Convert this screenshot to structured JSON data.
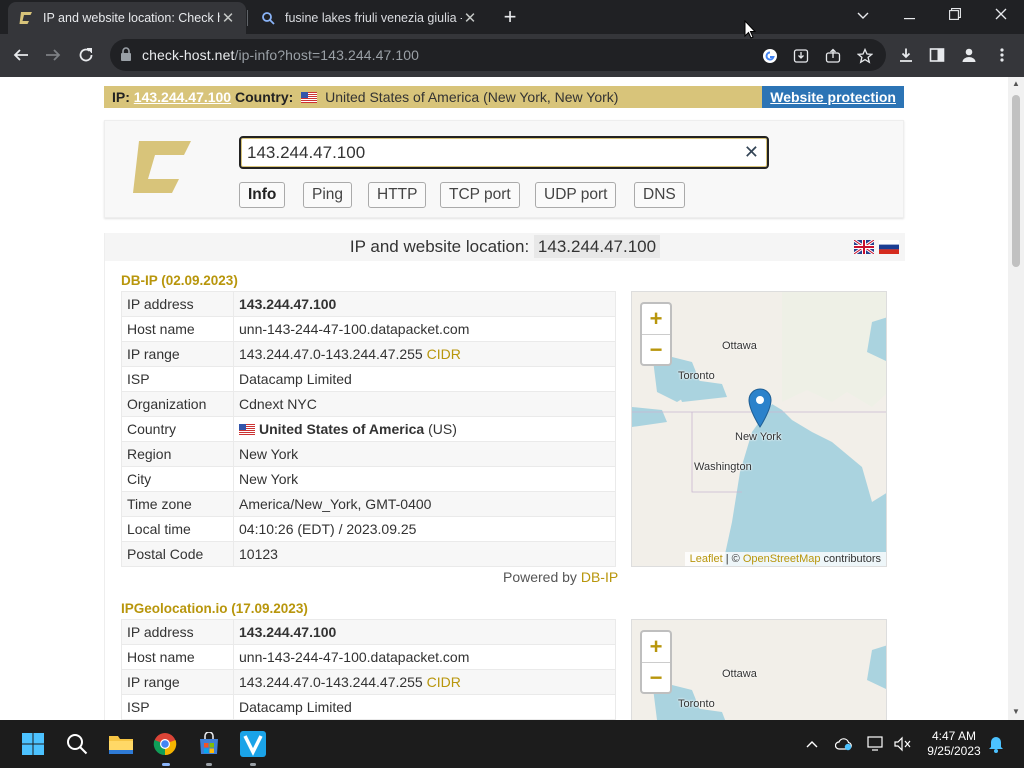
{
  "browser": {
    "tabs": [
      {
        "title": "IP and website location: Check ho",
        "active": true
      },
      {
        "title": "fusine lakes friuli venezia giulia -",
        "active": false
      }
    ],
    "new_tab": "+",
    "url_domain": "check-host.net",
    "url_rest": "/ip-info?host=143.244.47.100"
  },
  "topbar": {
    "ip_label": "IP:",
    "ip": "143.244.47.100",
    "country_label": "Country:",
    "country": "United States of America (New York, New York)",
    "protection": "Website protection"
  },
  "search": {
    "value": "143.244.47.100",
    "buttons": [
      "Info",
      "Ping",
      "HTTP",
      "TCP port",
      "UDP port",
      "DNS"
    ]
  },
  "panel": {
    "heading": "IP and website location:",
    "heading_ip": "143.244.47.100"
  },
  "sources": [
    {
      "title": "DB-IP (02.09.2023)",
      "rows": [
        {
          "key": "IP address",
          "value": "143.244.47.100"
        },
        {
          "key": "Host name",
          "value": "unn-143-244-47-100.datapacket.com"
        },
        {
          "key": "IP range",
          "value": "143.244.47.0-143.244.47.255",
          "extra": "CIDR"
        },
        {
          "key": "ISP",
          "value": "Datacamp Limited"
        },
        {
          "key": "Organization",
          "value": "Cdnext NYC"
        },
        {
          "key": "Country",
          "value": "United States of America",
          "extra": "(US)"
        },
        {
          "key": "Region",
          "value": "New York"
        },
        {
          "key": "City",
          "value": "New York"
        },
        {
          "key": "Time zone",
          "value": "America/New_York, GMT-0400"
        },
        {
          "key": "Local time",
          "value": "04:10:26 (EDT) / 2023.09.25"
        },
        {
          "key": "Postal Code",
          "value": "10123"
        }
      ],
      "powered_prefix": "Powered by",
      "powered_name": "DB-IP"
    },
    {
      "title": "IPGeolocation.io (17.09.2023)",
      "rows": [
        {
          "key": "IP address",
          "value": "143.244.47.100"
        },
        {
          "key": "Host name",
          "value": "unn-143-244-47-100.datapacket.com"
        },
        {
          "key": "IP range",
          "value": "143.244.47.0-143.244.47.255",
          "extra": "CIDR"
        },
        {
          "key": "ISP",
          "value": "Datacamp Limited"
        }
      ]
    }
  ],
  "map": {
    "zoom_in": "+",
    "zoom_out": "−",
    "labels": {
      "ottawa": "Ottawa",
      "toronto": "Toronto",
      "newyork": "New York",
      "washington": "Washington"
    },
    "attrib_leaflet": "Leaflet",
    "attrib_sep": " | © ",
    "attrib_osm": "OpenStreetMap",
    "attrib_tail": " contributors"
  },
  "taskbar": {
    "time": "4:47 AM",
    "date": "9/25/2023"
  },
  "colors": {
    "accent_gold": "#b8960c",
    "ipbar": "#d8c47a",
    "protect_blue": "#2c74b5"
  }
}
